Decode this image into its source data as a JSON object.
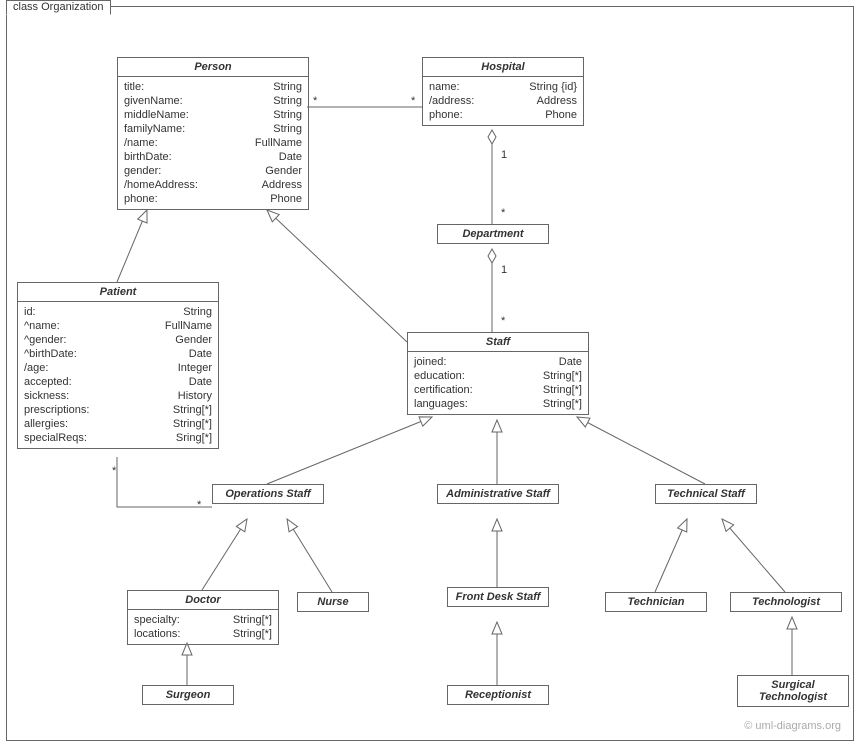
{
  "frame": {
    "title": "class Organization"
  },
  "credit": "© uml-diagrams.org",
  "classes": {
    "person": {
      "name": "Person",
      "attrs": [
        {
          "k": "title:",
          "t": "String"
        },
        {
          "k": "givenName:",
          "t": "String"
        },
        {
          "k": "middleName:",
          "t": "String"
        },
        {
          "k": "familyName:",
          "t": "String"
        },
        {
          "k": "/name:",
          "t": "FullName"
        },
        {
          "k": "birthDate:",
          "t": "Date"
        },
        {
          "k": "gender:",
          "t": "Gender"
        },
        {
          "k": "/homeAddress:",
          "t": "Address"
        },
        {
          "k": "phone:",
          "t": "Phone"
        }
      ]
    },
    "hospital": {
      "name": "Hospital",
      "attrs": [
        {
          "k": "name:",
          "t": "String {id}"
        },
        {
          "k": "/address:",
          "t": "Address"
        },
        {
          "k": "phone:",
          "t": "Phone"
        }
      ]
    },
    "department": {
      "name": "Department"
    },
    "patient": {
      "name": "Patient",
      "attrs": [
        {
          "k": "id:",
          "t": "String"
        },
        {
          "k": "^name:",
          "t": "FullName"
        },
        {
          "k": "^gender:",
          "t": "Gender"
        },
        {
          "k": "^birthDate:",
          "t": "Date"
        },
        {
          "k": "/age:",
          "t": "Integer"
        },
        {
          "k": "accepted:",
          "t": "Date"
        },
        {
          "k": "sickness:",
          "t": "History"
        },
        {
          "k": "prescriptions:",
          "t": "String[*]"
        },
        {
          "k": "allergies:",
          "t": "String[*]"
        },
        {
          "k": "specialReqs:",
          "t": "Sring[*]"
        }
      ]
    },
    "staff": {
      "name": "Staff",
      "attrs": [
        {
          "k": "joined:",
          "t": "Date"
        },
        {
          "k": "education:",
          "t": "String[*]"
        },
        {
          "k": "certification:",
          "t": "String[*]"
        },
        {
          "k": "languages:",
          "t": "String[*]"
        }
      ]
    },
    "opsStaff": {
      "name": "Operations Staff"
    },
    "adminStaff": {
      "name": "Administrative Staff"
    },
    "techStaff": {
      "name": "Technical Staff"
    },
    "doctor": {
      "name": "Doctor",
      "attrs": [
        {
          "k": "specialty:",
          "t": "String[*]"
        },
        {
          "k": "locations:",
          "t": "String[*]"
        }
      ]
    },
    "nurse": {
      "name": "Nurse"
    },
    "frontDesk": {
      "name": "Front Desk Staff"
    },
    "technician": {
      "name": "Technician"
    },
    "technologist": {
      "name": "Technologist"
    },
    "surgeon": {
      "name": "Surgeon"
    },
    "receptionist": {
      "name": "Receptionist"
    },
    "surgTech": {
      "name": "Surgical Technologist"
    }
  },
  "mults": {
    "ph_l": "*",
    "ph_r": "*",
    "hd_h": "1",
    "hd_d": "*",
    "ds_d": "1",
    "ds_s": "*",
    "po_l": "*",
    "po_r": "*"
  }
}
